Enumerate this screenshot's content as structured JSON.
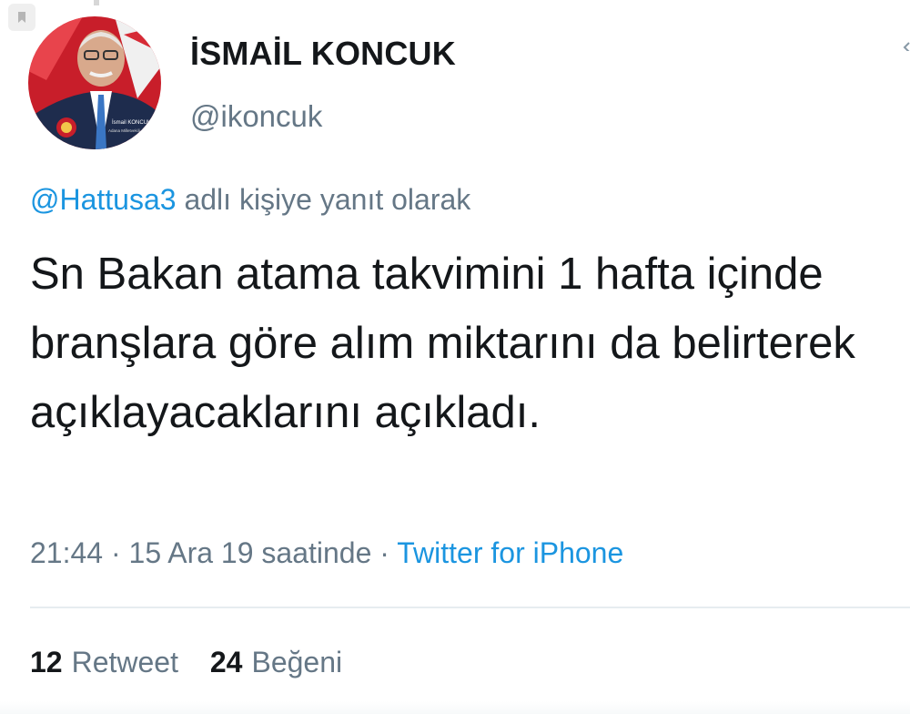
{
  "colors": {
    "text_primary": "#14171a",
    "text_secondary": "#657786",
    "link_blue": "#1b95e0",
    "divider": "#e6ecf0"
  },
  "icons": {
    "bookmark": "bookmark-icon",
    "more": "more-icon"
  },
  "user": {
    "display_name": "İSMAİL KONCUK",
    "handle": "@ikoncuk",
    "avatar_caption_name": "İsmail KONCUK",
    "avatar_caption_role": "Adana Milletvekili"
  },
  "tweet": {
    "reply_mention": "@Hattusa3",
    "reply_suffix": " adlı kişiye yanıt olarak",
    "text": "Sn Bakan atama takvimini 1 hafta içinde branşlara göre alım miktarını da belirterek açıklayacaklarını açıkladı.",
    "timestamp": "21:44 · 15 Ara 19 saatinde",
    "separator": " · ",
    "source": "Twitter for iPhone"
  },
  "stats": {
    "retweet_count": "12",
    "retweet_label": "Retweet",
    "like_count": "24",
    "like_label": "Beğeni"
  }
}
